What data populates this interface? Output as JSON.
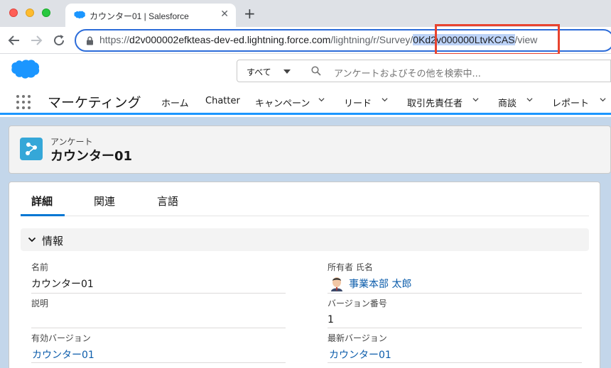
{
  "browser": {
    "tab_title": "カウンター01 | Salesforce",
    "tab_close": "✕",
    "new_tab": "+",
    "url_prefix": "https://",
    "url_host": "d2v000002efkteas-dev-ed.lightning.force.com",
    "url_path": "/lightning/r/Survey/",
    "url_highlight": "0Kd2v000000LtvKCAS",
    "url_suffix": "/view"
  },
  "header": {
    "search_scope": "すべて",
    "search_placeholder": "アンケートおよびその他を検索中..."
  },
  "appnav": {
    "app_name": "マーケティング",
    "items": [
      {
        "label": "ホーム",
        "dropdown": false
      },
      {
        "label": "Chatter",
        "dropdown": false
      },
      {
        "label": "キャンペーン",
        "dropdown": true
      },
      {
        "label": "リード",
        "dropdown": true
      },
      {
        "label": "取引先責任者",
        "dropdown": true
      },
      {
        "label": "商談",
        "dropdown": true
      },
      {
        "label": "レポート",
        "dropdown": true
      }
    ]
  },
  "record": {
    "object_type": "アンケート",
    "name": "カウンター01"
  },
  "tabs": [
    {
      "label": "詳細",
      "active": true
    },
    {
      "label": "関連",
      "active": false
    },
    {
      "label": "言語",
      "active": false
    }
  ],
  "section": {
    "title": "情報"
  },
  "fields": {
    "name_label": "名前",
    "name_value": "カウンター01",
    "owner_label": "所有者 氏名",
    "owner_value": "事業本部 太郎",
    "description_label": "説明",
    "description_value": "",
    "version_number_label": "バージョン番号",
    "version_number_value": "1",
    "active_version_label": "有効バージョン",
    "active_version_value": "カウンター01",
    "latest_version_label": "最新バージョン",
    "latest_version_value": "カウンター01"
  },
  "colors": {
    "brand": "#0176d3",
    "link": "#0b5cab",
    "highlight_box": "#e8432f"
  }
}
